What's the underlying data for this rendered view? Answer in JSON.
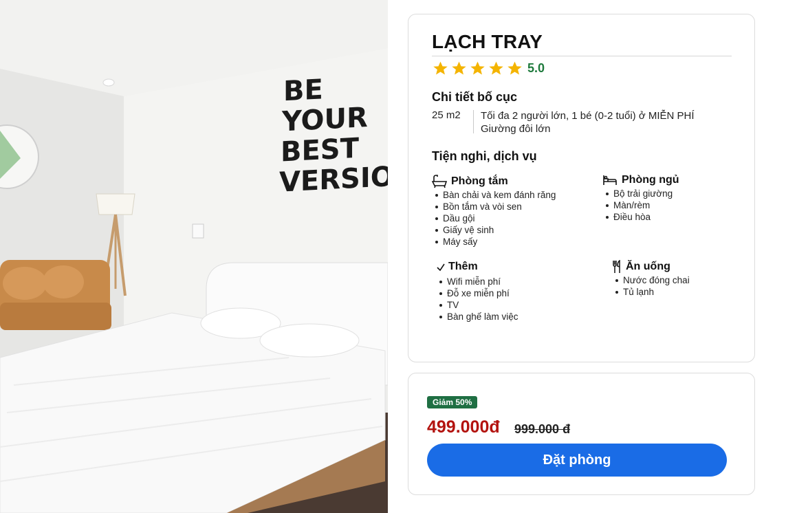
{
  "room": {
    "name": "LẠCH TRAY",
    "rating_value": "5.0",
    "rating_stars": 5,
    "photo_wall_text": [
      "BE",
      "YOUR",
      "BEST",
      "VERSION"
    ]
  },
  "layout": {
    "heading": "Chi tiết bố cục",
    "area": "25 m2",
    "occupancy": "Tối đa 2 người lớn, 1 bé (0-2 tuổi) ở MIỄN PHÍ",
    "bed": "Giường đôi lớn"
  },
  "amenities": {
    "heading": "Tiện nghi, dịch vụ",
    "groups": [
      {
        "icon": "bathtub-icon",
        "title": "Phòng tắm",
        "items": [
          "Bàn chải và kem đánh răng",
          "Bồn tắm và vòi sen",
          "Dầu gội",
          "Giấy vệ sinh",
          "Máy sấy"
        ]
      },
      {
        "icon": "bed-icon",
        "title": "Phòng ngủ",
        "items": [
          "Bộ trải giường",
          "Màn/rèm",
          "Điều hòa"
        ]
      },
      {
        "icon": "check-icon",
        "title": "Thêm",
        "items": [
          "Wifi miễn phí",
          "Đỗ xe miễn phí",
          "TV",
          "Bàn ghế làm việc"
        ]
      },
      {
        "icon": "utensils-icon",
        "title": "Ăn uống",
        "items": [
          "Nước đóng chai",
          "Tủ lạnh"
        ]
      }
    ]
  },
  "pricing": {
    "discount_badge": "Giảm 50%",
    "price_now": "499.000đ",
    "price_old": "999.000 đ",
    "book_label": "Đặt phòng"
  },
  "colors": {
    "star": "#f4b400",
    "rating_text": "#1e7a3c",
    "badge_bg": "#1f6f43",
    "price_now": "#b3130f",
    "book_button": "#1a6ce6"
  }
}
